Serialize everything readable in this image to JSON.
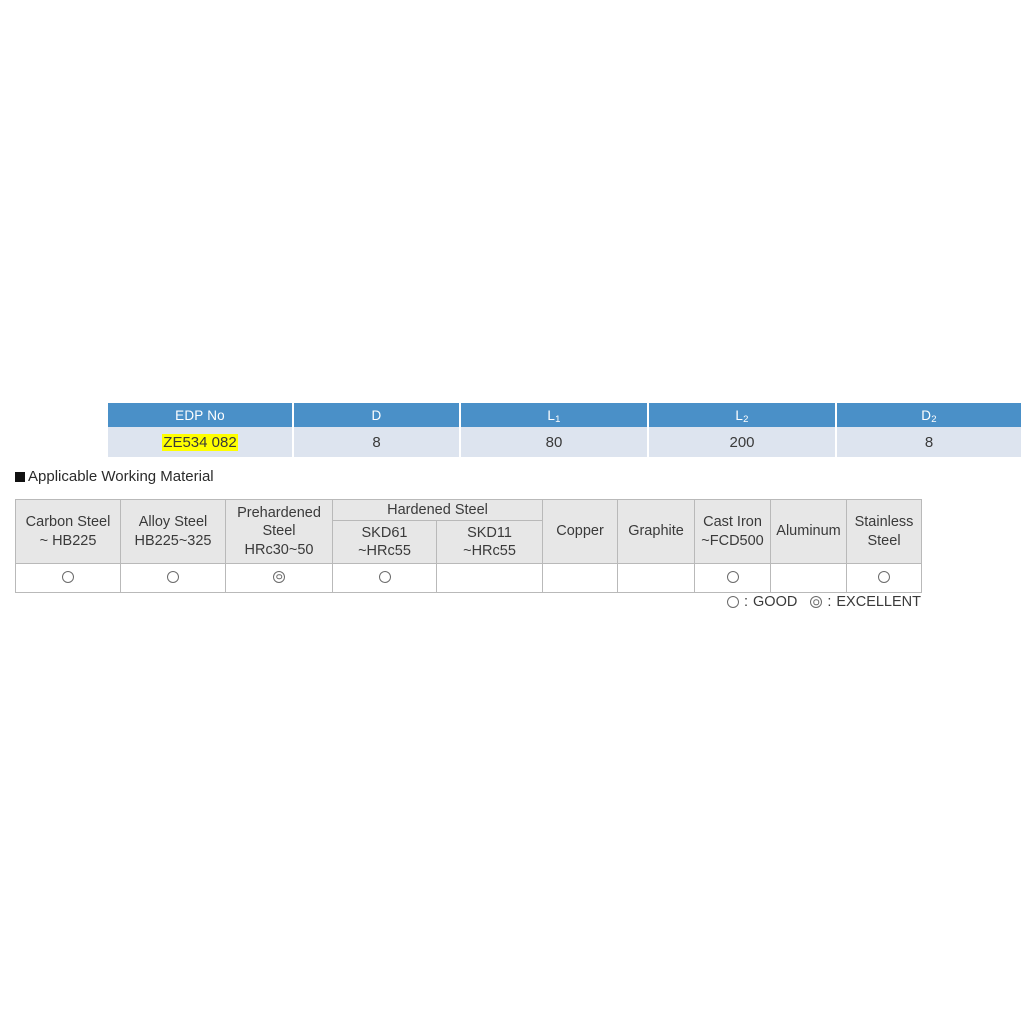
{
  "spec_table": {
    "columns": [
      {
        "label": "EDP No",
        "sub": ""
      },
      {
        "label": "D",
        "sub": ""
      },
      {
        "label": "L",
        "sub": "1"
      },
      {
        "label": "L",
        "sub": "2"
      },
      {
        "label": "D",
        "sub": "2"
      }
    ],
    "row": {
      "edp_no": "ZE534 082",
      "edp_no_highlighted": true,
      "D": "8",
      "L1": "80",
      "L2": "200",
      "D2": "8"
    },
    "header_bg": "#4a90c8",
    "header_text_color": "#ffffff",
    "row_bg": "#dde4ef",
    "highlight_color": "#ffff00"
  },
  "material_section": {
    "heading": "Applicable Working Material",
    "heading_marker": "filled-square-bullet",
    "columns": [
      {
        "name": "carbon-steel",
        "line1": "Carbon Steel",
        "line2": "~ HB225",
        "rating": "good"
      },
      {
        "name": "alloy-steel",
        "line1": "Alloy Steel",
        "line2": "HB225~325",
        "rating": "good"
      },
      {
        "name": "prehardened-steel",
        "line1": "Prehardened",
        "line2": "Steel",
        "line3": "HRc30~50",
        "rating": "excellent"
      },
      {
        "name": "hardened-steel-skd61",
        "group": "Hardened Steel",
        "line1": "SKD61",
        "line2": "~HRc55",
        "rating": "good"
      },
      {
        "name": "hardened-steel-skd11",
        "group": "Hardened Steel",
        "line1": "SKD11",
        "line2": "~HRc55",
        "rating": ""
      },
      {
        "name": "copper",
        "line1": "Copper",
        "line2": "",
        "rating": ""
      },
      {
        "name": "graphite",
        "line1": "Graphite",
        "line2": "",
        "rating": ""
      },
      {
        "name": "cast-iron",
        "line1": "Cast Iron",
        "line2": "~FCD500",
        "rating": "good"
      },
      {
        "name": "aluminum",
        "line1": "Aluminum",
        "line2": "",
        "rating": ""
      },
      {
        "name": "stainless-steel",
        "line1": "Stainless",
        "line2": "Steel",
        "rating": "good"
      }
    ],
    "group_header": "Hardened Steel",
    "header_bg": "#e7e7e7",
    "border_color": "#b9b9b9"
  },
  "legend": {
    "good_symbol": "circle-outline",
    "good_separator": ":",
    "good_label": "GOOD",
    "excellent_symbol": "double-circle",
    "excellent_separator": ":",
    "excellent_label": "EXCELLENT"
  }
}
